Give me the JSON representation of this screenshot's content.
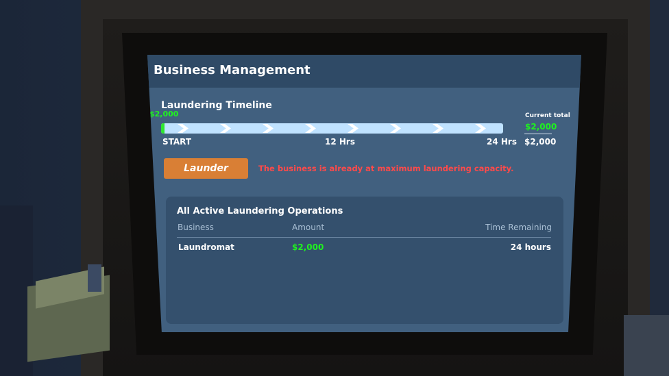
{
  "screen": {
    "title": "Business Management"
  },
  "timeline": {
    "title": "Laundering Timeline",
    "start_amount": "$2,000",
    "progress_percent": 1,
    "ticks": [
      "START",
      "12 Hrs",
      "24 Hrs"
    ],
    "current_total_label": "Current total",
    "current_total_pending": "$2,000",
    "current_total": "$2,000"
  },
  "actions": {
    "launder_label": "Launder",
    "error_message": "The business is already at maximum laundering capacity."
  },
  "operations": {
    "title": "All Active Laundering Operations",
    "columns": [
      "Business",
      "Amount",
      "Time Remaining"
    ],
    "rows": [
      {
        "business": "Laundromat",
        "amount": "$2,000",
        "time_remaining": "24 hours"
      }
    ]
  },
  "colors": {
    "accent_green": "#1ff21f",
    "launder_orange": "#d97f35",
    "error_red": "#ff4a4a",
    "panel_blue": "#41607f"
  }
}
